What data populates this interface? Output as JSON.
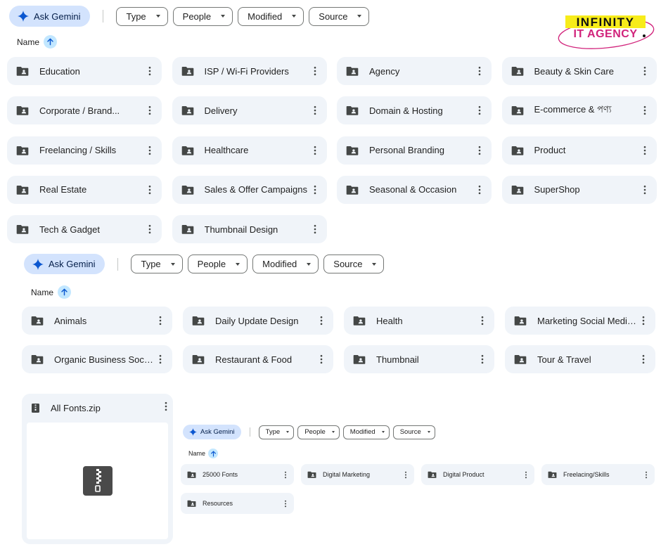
{
  "toolbar": {
    "ask_gemini": "Ask Gemini",
    "filters": [
      "Type",
      "People",
      "Modified",
      "Source"
    ]
  },
  "sort": {
    "label": "Name",
    "direction": "ascending"
  },
  "logo": {
    "line1": "INFINITY",
    "line2": "IT AGENCY",
    "accent_color": "#d1237b",
    "highlight_color": "#f7ec1a"
  },
  "section1_folders": [
    "Education",
    "ISP / Wi-Fi Providers",
    "Agency",
    "Beauty & Skin Care",
    "Corporate / Brand...",
    "Delivery",
    "Domain & Hosting",
    "E-commerce & পণ্য",
    "Freelancing / Skills",
    "Healthcare",
    "Personal Branding",
    "Product",
    "Real Estate",
    "Sales & Offer Campaigns",
    "Seasonal & Occasion",
    "SuperShop",
    "Tech & Gadget",
    "Thumbnail Design"
  ],
  "section2_folders": [
    "Animals",
    "Daily Update Design",
    "Health",
    "Marketing Social Media...",
    "Organic Business Social...",
    "Restaurant & Food",
    "Thumbnail",
    "Tour & Travel"
  ],
  "zip_file": {
    "name": "All Fonts.zip"
  },
  "section3_folders": [
    "25000 Fonts",
    "Digital Marketing",
    "Digital Product",
    "Freelacing/Skills",
    "Resources"
  ],
  "colors": {
    "folder_bg": "#f0f4f9",
    "gemini_bg": "#d3e3fd",
    "sort_badge": "#c2e7ff",
    "icon": "#444746"
  }
}
